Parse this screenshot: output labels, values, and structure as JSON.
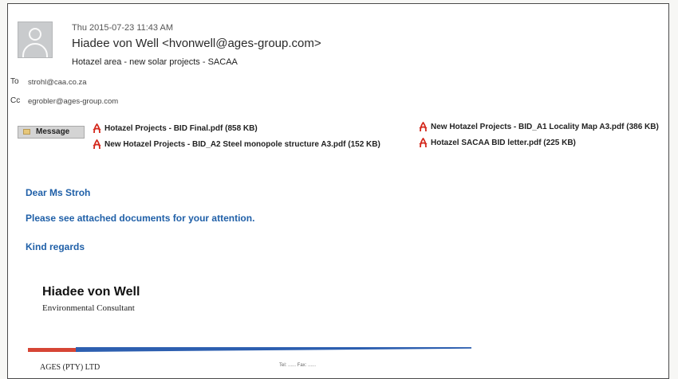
{
  "header": {
    "date": "Thu 2015-07-23 11:43 AM",
    "from": "Hiadee von Well <hvonwell@ages-group.com>",
    "subject": "Hotazel area - new solar projects - SACAA",
    "to_label": "To",
    "to_value": "strohl@caa.co.za",
    "cc_label": "Cc",
    "cc_value": "egrobler@ages-group.com"
  },
  "attachments": {
    "message_tab": "Message",
    "items": [
      {
        "label": "Hotazel Projects - BID Final.pdf (858 KB)",
        "icon": "pdf-icon"
      },
      {
        "label": "New Hotazel Projects - BID_A2 Steel monopole structure A3.pdf (152 KB)",
        "icon": "pdf-icon"
      },
      {
        "label": "New Hotazel Projects - BID_A1 Locality Map A3.pdf (386 KB)",
        "icon": "pdf-icon"
      },
      {
        "label": "Hotazel SACAA BID letter.pdf (225 KB)",
        "icon": "pdf-icon"
      }
    ]
  },
  "body": {
    "greeting": "Dear Ms Stroh",
    "line1": "Please see attached documents for your attention.",
    "closing": "Kind regards"
  },
  "signature": {
    "name": "Hiadee von Well",
    "title": "Environmental Consultant",
    "company": "AGES (PTY) LTD",
    "contact": "Tel: ...... Fax: ......"
  },
  "colors": {
    "body_text": "#2060a8",
    "bar_red": "#d64535",
    "bar_blue": "#2d5fb0"
  }
}
